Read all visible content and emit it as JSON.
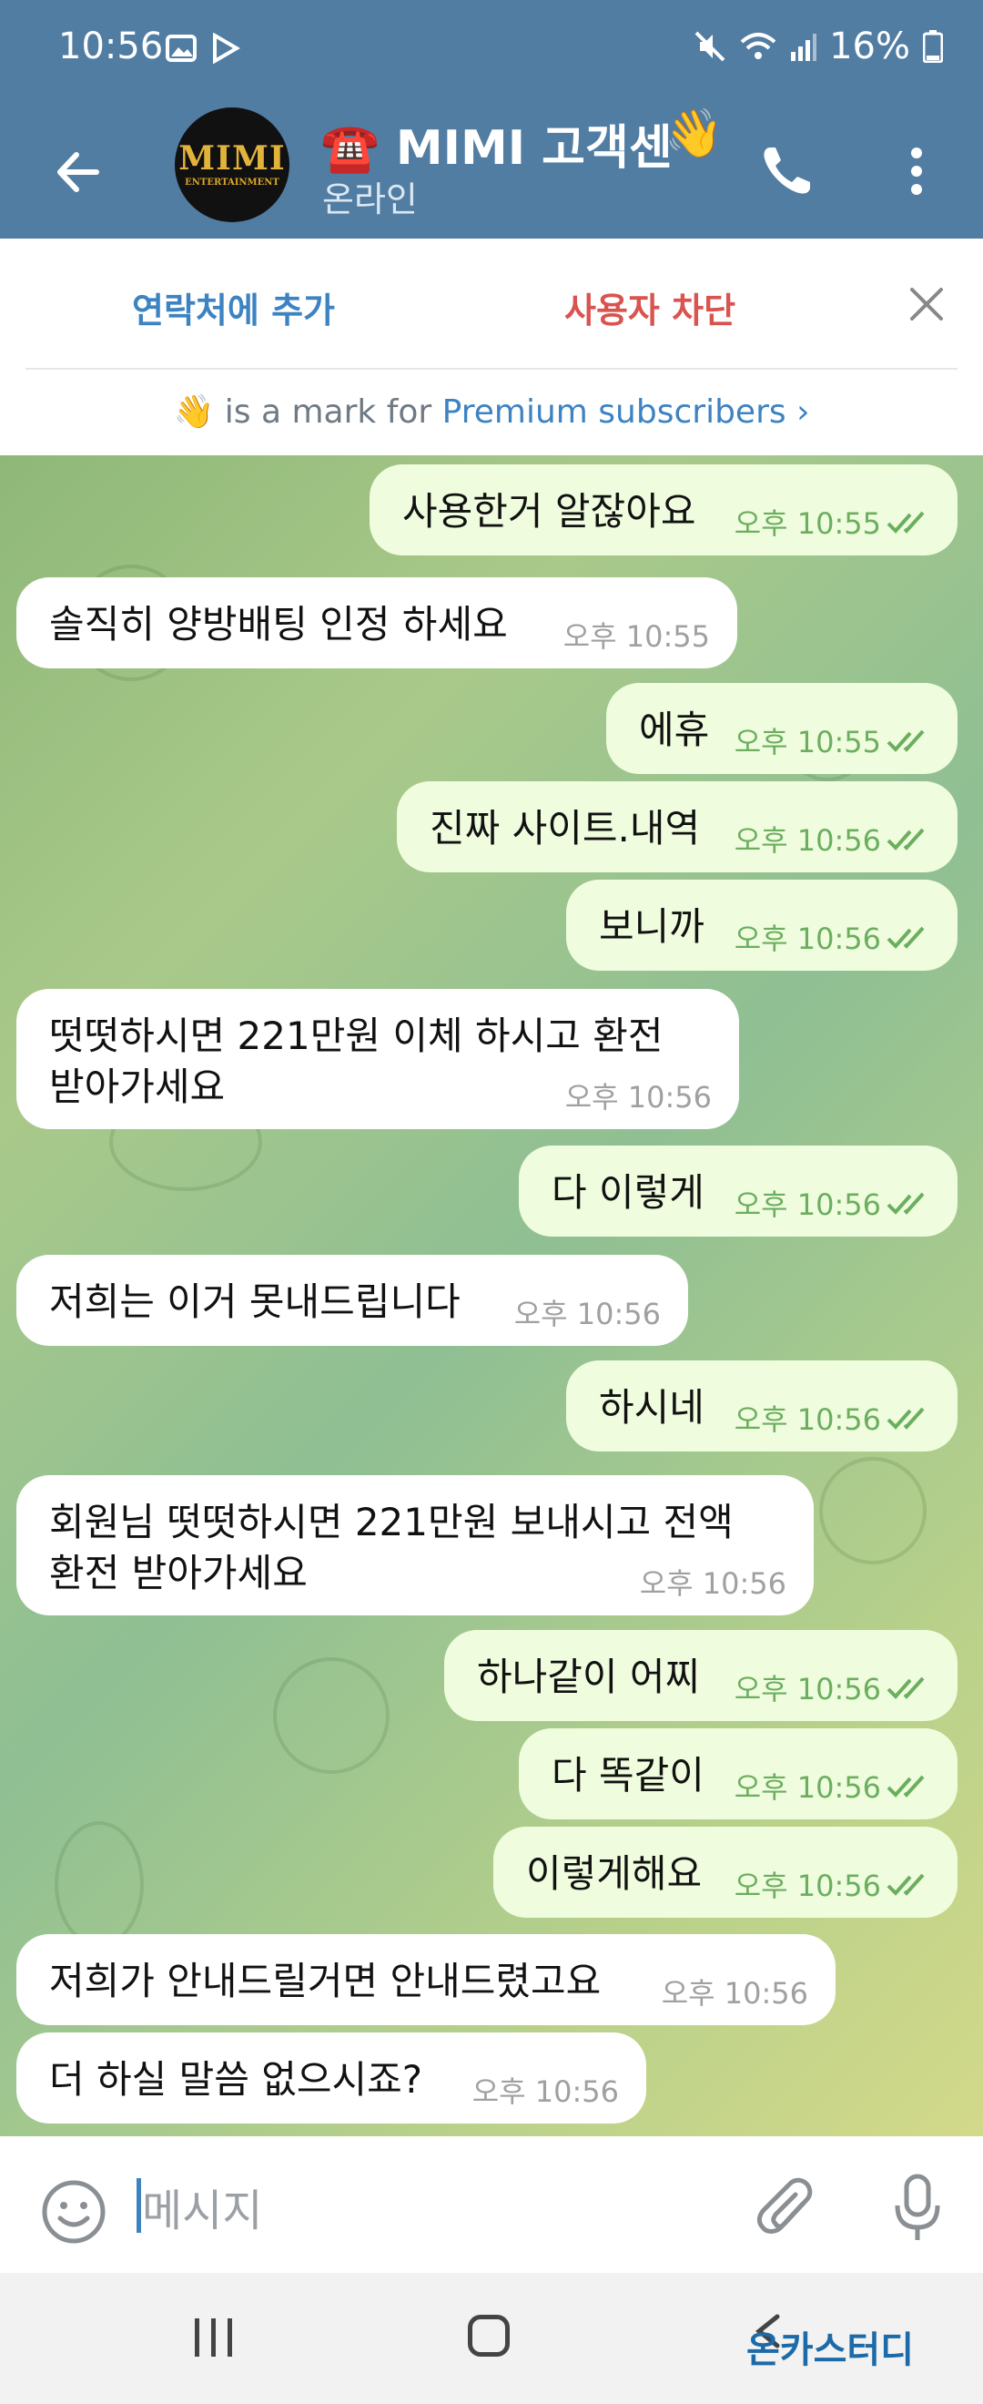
{
  "status_bar": {
    "time": "10:56",
    "battery": "16%"
  },
  "header": {
    "title": "☎️ MIMI 고객센",
    "title_emoji": "👋",
    "status": "온라인",
    "avatar_text": "MIMI",
    "avatar_subtext": "ENTERTAINMENT"
  },
  "actions": {
    "add_contact": "연락처에 추가",
    "block_user": "사용자 차단"
  },
  "premium": {
    "emoji": "👋",
    "text": " is a mark for ",
    "link": "Premium subscribers ›"
  },
  "messages": [
    {
      "dir": "out",
      "text": "사용한거 알잖아요",
      "time": "오후 10:55"
    },
    {
      "dir": "in",
      "text": "솔직히 양방배팅 인정 하세요",
      "time": "오후 10:55"
    },
    {
      "dir": "out",
      "text": "에휴",
      "time": "오후 10:55"
    },
    {
      "dir": "out",
      "text": "진짜 사이트.내역",
      "time": "오후 10:56"
    },
    {
      "dir": "out",
      "text": "보니까",
      "time": "오후 10:56"
    },
    {
      "dir": "in",
      "text": "떳떳하시면 221만원 이체 하시고 환전",
      "text2": "받아가세요",
      "time": "오후 10:56"
    },
    {
      "dir": "out",
      "text": "다 이렇게",
      "time": "오후 10:56"
    },
    {
      "dir": "in",
      "text": "저희는 이거 못내드립니다",
      "time": "오후 10:56"
    },
    {
      "dir": "out",
      "text": "하시네",
      "time": "오후 10:56"
    },
    {
      "dir": "in",
      "text": "회원님 떳떳하시면 221만원 보내시고 전액",
      "text2": "환전 받아가세요",
      "time": "오후 10:56"
    },
    {
      "dir": "out",
      "text": "하나같이 어찌",
      "time": "오후 10:56"
    },
    {
      "dir": "out",
      "text": "다 똑같이",
      "time": "오후 10:56"
    },
    {
      "dir": "out",
      "text": "이렇게해요",
      "time": "오후 10:56"
    },
    {
      "dir": "in",
      "text": "저희가 안내드릴거면 안내드렸고요",
      "time": "오후 10:56"
    },
    {
      "dir": "in",
      "text": "더 하실 말씀 없으시죠?",
      "time": "오후 10:56"
    }
  ],
  "input": {
    "placeholder": "메시지"
  },
  "watermark": "온카스터디",
  "colors": {
    "header": "#527da3",
    "outgoing_bubble": "#effdde",
    "incoming_bubble": "#ffffff",
    "link": "#3d83c2",
    "block": "#d9534f",
    "check": "#6cae5f"
  }
}
